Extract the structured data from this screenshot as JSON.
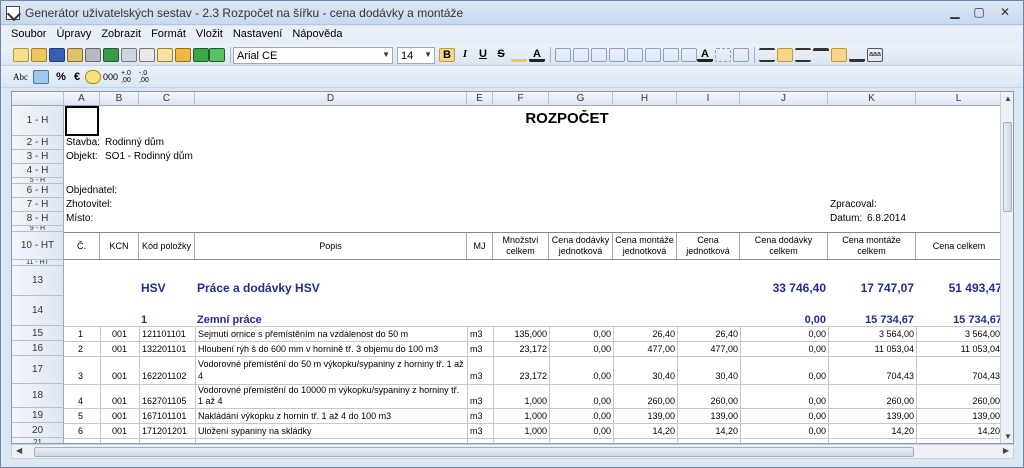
{
  "window": {
    "title": "Generátor uživatelských sestav  - 2.3 Rozpočet na šířku - cena dodávky a montáže"
  },
  "menu": [
    "Soubor",
    "Úpravy",
    "Zobrazit",
    "Formát",
    "Vložit",
    "Nastavení",
    "Nápověda"
  ],
  "toolbar": {
    "font": "Arial CE",
    "size": "14",
    "bold": "B",
    "italic": "I",
    "underline": "U",
    "strike": "S",
    "abc": "Abc",
    "percent": "%",
    "euro": "€",
    "zeros": "000"
  },
  "columns": [
    "A",
    "B",
    "C",
    "D",
    "E",
    "F",
    "G",
    "H",
    "I",
    "J",
    "K",
    "L"
  ],
  "rows": {
    "r1": "1 - H",
    "r2": "2 - H",
    "r3": "3 - H",
    "r4": "4 - H",
    "r5": "5 - H",
    "r6": "6 - H",
    "r7": "7 - H",
    "r8": "8 - H",
    "r9": "9 - H",
    "r10": "10 - HT",
    "r11": "11 - HT",
    "r13": "13",
    "r14": "14",
    "r15": "15",
    "r16": "16",
    "r17": "17",
    "r18": "18",
    "r19": "19",
    "r20": "20",
    "r21": "21"
  },
  "doc": {
    "title": "ROZPOČET",
    "stavba_label": "Stavba:",
    "stavba": "Rodinný dům",
    "objekt_label": "Objekt:",
    "objekt": "SO1 - Rodinný dům",
    "objednatel": "Objednatel:",
    "zhotovitel": "Zhotovitel:",
    "misto": "Místo:",
    "zpracoval": "Zpracoval:",
    "datum_label": "Datum:",
    "datum": "6.8.2014"
  },
  "headers": {
    "c": "Č.",
    "kcn": "KCN",
    "kod": "Kód položky",
    "popis": "Popis",
    "mj": "MJ",
    "mnozstvi": "Množství celkem",
    "cdj": "Cena dodávky jednotková",
    "cmj": "Cena montáže jednotková",
    "cj": "Cena jednotková",
    "cdc": "Cena dodávky celkem",
    "cmc": "Cena montáže celkem",
    "cc": "Cena celkem"
  },
  "hsv": {
    "code": "HSV",
    "name": "Práce a dodávky HSV",
    "dod": "33 746,40",
    "mon": "17 747,07",
    "cel": "51 493,47"
  },
  "group1": {
    "code": "1",
    "name": "Zemní práce",
    "dod": "0,00",
    "mon": "15 734,67",
    "cel": "15 734,67"
  },
  "items": [
    {
      "c": "1",
      "kcn": "001",
      "kod": "121101101",
      "popis": "Sejmutí ornice s přemístěním na vzdálenost do 50 m",
      "mj": "m3",
      "mn": "135,000",
      "cdj": "0,00",
      "cmj": "26,40",
      "cj": "26,40",
      "cdc": "0,00",
      "cmc": "3 564,00",
      "cc": "3 564,00"
    },
    {
      "c": "2",
      "kcn": "001",
      "kod": "132201101",
      "popis": "Hloubení rýh š do 600 mm v hornině tř. 3 objemu do 100 m3",
      "mj": "m3",
      "mn": "23,172",
      "cdj": "0,00",
      "cmj": "477,00",
      "cj": "477,00",
      "cdc": "0,00",
      "cmc": "11 053,04",
      "cc": "11 053,04"
    },
    {
      "c": "3",
      "kcn": "001",
      "kod": "162201102",
      "popis": "Vodorovné přemístění do 50 m výkopku/sypaniny z horniny tř. 1 až 4",
      "mj": "m3",
      "mn": "23,172",
      "cdj": "0,00",
      "cmj": "30,40",
      "cj": "30,40",
      "cdc": "0,00",
      "cmc": "704,43",
      "cc": "704,43"
    },
    {
      "c": "4",
      "kcn": "001",
      "kod": "162701105",
      "popis": "Vodorovné přemístění do 10000 m výkopku/sypaniny z horniny tř. 1 až 4",
      "mj": "m3",
      "mn": "1,000",
      "cdj": "0,00",
      "cmj": "260,00",
      "cj": "260,00",
      "cdc": "0,00",
      "cmc": "260,00",
      "cc": "260,00"
    },
    {
      "c": "5",
      "kcn": "001",
      "kod": "167101101",
      "popis": "Nakládání výkopku z hornin tř. 1 až 4 do 100 m3",
      "mj": "m3",
      "mn": "1,000",
      "cdj": "0,00",
      "cmj": "139,00",
      "cj": "139,00",
      "cdc": "0,00",
      "cmc": "139,00",
      "cc": "139,00"
    },
    {
      "c": "6",
      "kcn": "001",
      "kod": "171201201",
      "popis": "Uložení sypaniny na skládky",
      "mj": "m3",
      "mn": "1,000",
      "cdj": "0,00",
      "cmj": "14,20",
      "cj": "14,20",
      "cdc": "0,00",
      "cmc": "14,20",
      "cc": "14,20"
    }
  ]
}
